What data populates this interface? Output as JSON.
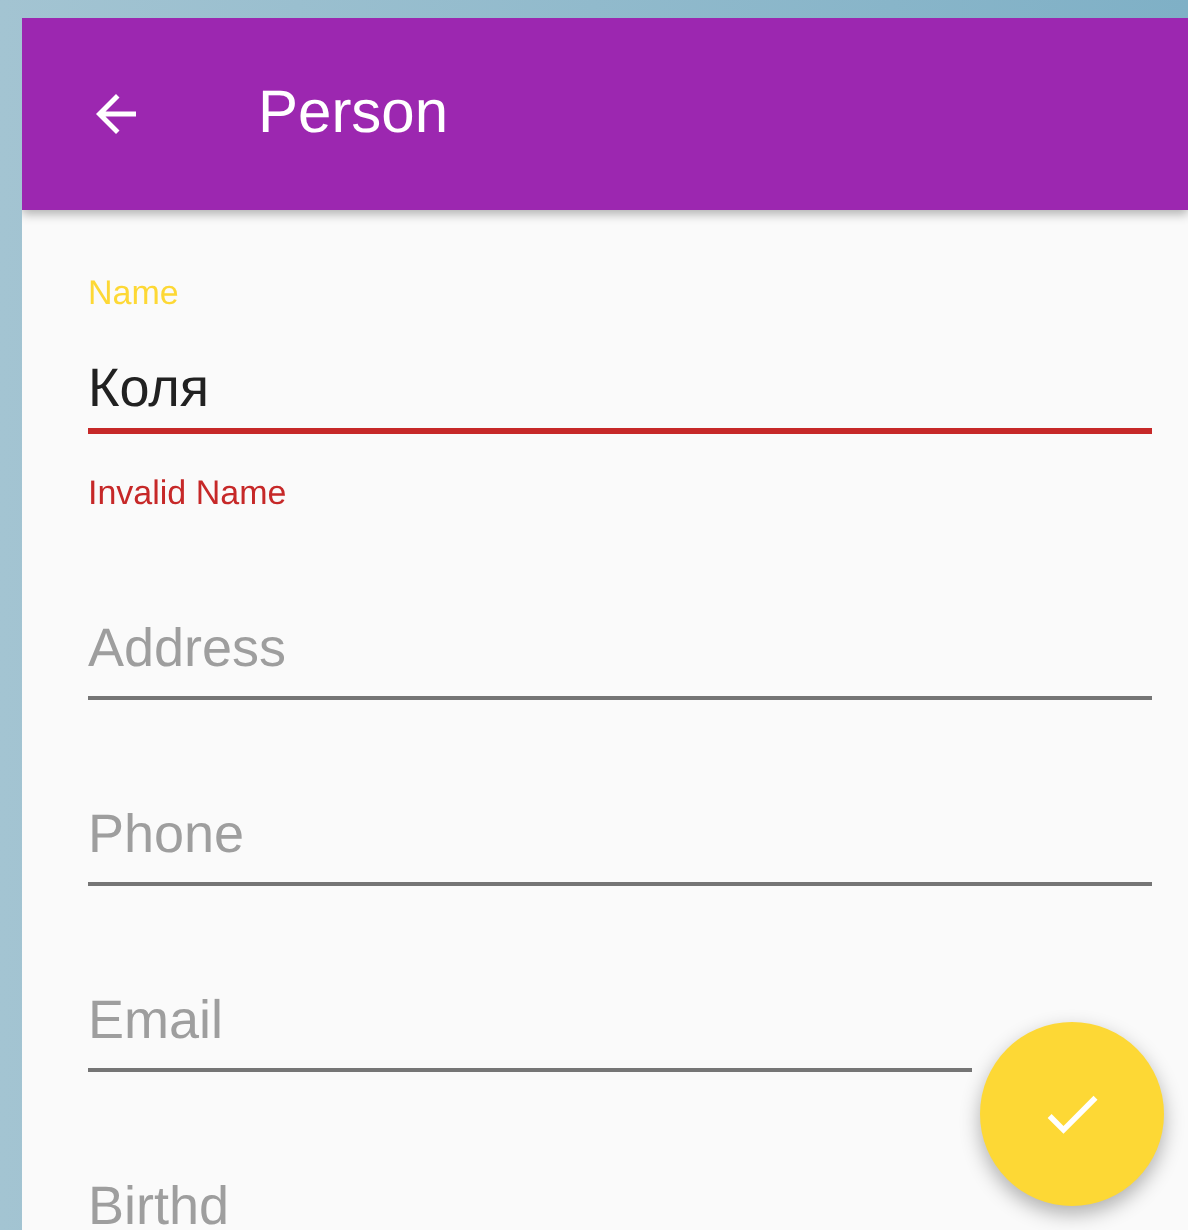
{
  "toolbar": {
    "title": "Person"
  },
  "fields": [
    {
      "kind": "filled",
      "label": "Name",
      "value": "Коля",
      "error": "Invalid Name"
    },
    {
      "kind": "empty",
      "placeholder": "Address"
    },
    {
      "kind": "empty",
      "placeholder": "Phone"
    },
    {
      "kind": "empty",
      "placeholder": "Email"
    },
    {
      "kind": "empty",
      "placeholder": "Birthd"
    }
  ]
}
